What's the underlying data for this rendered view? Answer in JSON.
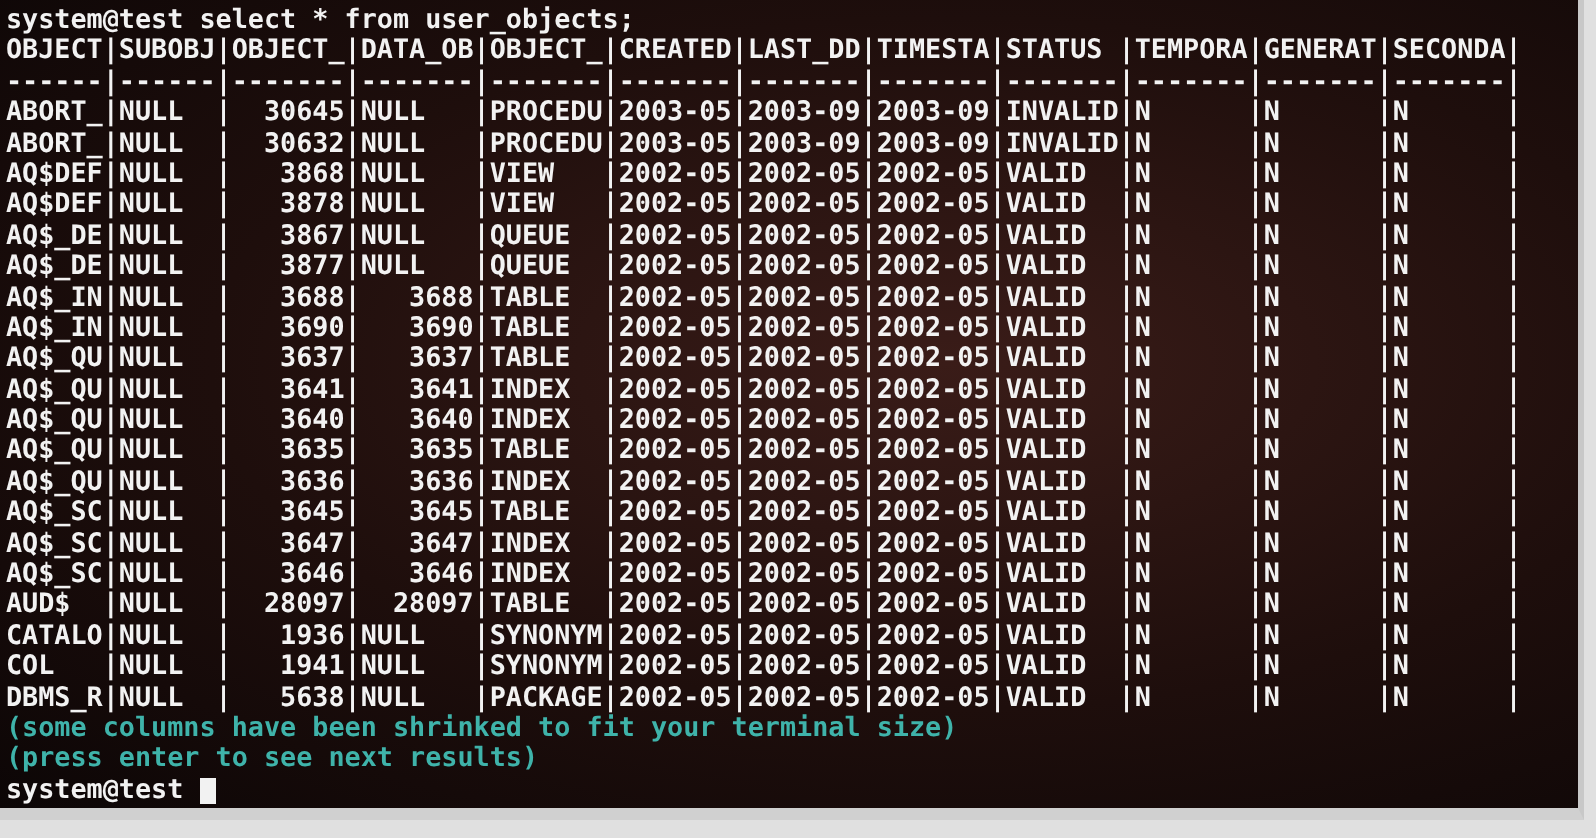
{
  "terminal": {
    "lines": [
      {
        "kind": "command",
        "text": "system@test select * from user_objects;"
      },
      {
        "kind": "output",
        "text": "OBJECT|SUBOBJ|OBJECT_|DATA_OB|OBJECT_|CREATED|LAST_DD|TIMESTA|STATUS |TEMPORA|GENERAT|SECONDA|"
      },
      {
        "kind": "output",
        "text": "------|------|-------|-------|-------|-------|-------|-------|-------|-------|-------|-------|"
      },
      {
        "kind": "output",
        "text": "ABORT_|NULL  |  30645|NULL   |PROCEDU|2003-05|2003-09|2003-09|INVALID|N      |N      |N      |"
      },
      {
        "kind": "output",
        "text": "ABORT_|NULL  |  30632|NULL   |PROCEDU|2003-05|2003-09|2003-09|INVALID|N      |N      |N      |"
      },
      {
        "kind": "output",
        "text": "AQ$DEF|NULL  |   3868|NULL   |VIEW   |2002-05|2002-05|2002-05|VALID  |N      |N      |N      |"
      },
      {
        "kind": "output",
        "text": "AQ$DEF|NULL  |   3878|NULL   |VIEW   |2002-05|2002-05|2002-05|VALID  |N      |N      |N      |"
      },
      {
        "kind": "output",
        "text": "AQ$_DE|NULL  |   3867|NULL   |QUEUE  |2002-05|2002-05|2002-05|VALID  |N      |N      |N      |"
      },
      {
        "kind": "output",
        "text": "AQ$_DE|NULL  |   3877|NULL   |QUEUE  |2002-05|2002-05|2002-05|VALID  |N      |N      |N      |"
      },
      {
        "kind": "output",
        "text": "AQ$_IN|NULL  |   3688|   3688|TABLE  |2002-05|2002-05|2002-05|VALID  |N      |N      |N      |"
      },
      {
        "kind": "output",
        "text": "AQ$_IN|NULL  |   3690|   3690|TABLE  |2002-05|2002-05|2002-05|VALID  |N      |N      |N      |"
      },
      {
        "kind": "output",
        "text": "AQ$_QU|NULL  |   3637|   3637|TABLE  |2002-05|2002-05|2002-05|VALID  |N      |N      |N      |"
      },
      {
        "kind": "output",
        "text": "AQ$_QU|NULL  |   3641|   3641|INDEX  |2002-05|2002-05|2002-05|VALID  |N      |N      |N      |"
      },
      {
        "kind": "output",
        "text": "AQ$_QU|NULL  |   3640|   3640|INDEX  |2002-05|2002-05|2002-05|VALID  |N      |N      |N      |"
      },
      {
        "kind": "output",
        "text": "AQ$_QU|NULL  |   3635|   3635|TABLE  |2002-05|2002-05|2002-05|VALID  |N      |N      |N      |"
      },
      {
        "kind": "output",
        "text": "AQ$_QU|NULL  |   3636|   3636|INDEX  |2002-05|2002-05|2002-05|VALID  |N      |N      |N      |"
      },
      {
        "kind": "output",
        "text": "AQ$_SC|NULL  |   3645|   3645|TABLE  |2002-05|2002-05|2002-05|VALID  |N      |N      |N      |"
      },
      {
        "kind": "output",
        "text": "AQ$_SC|NULL  |   3647|   3647|INDEX  |2002-05|2002-05|2002-05|VALID  |N      |N      |N      |"
      },
      {
        "kind": "output",
        "text": "AQ$_SC|NULL  |   3646|   3646|INDEX  |2002-05|2002-05|2002-05|VALID  |N      |N      |N      |"
      },
      {
        "kind": "output",
        "text": "AUD$  |NULL  |  28097|  28097|TABLE  |2002-05|2002-05|2002-05|VALID  |N      |N      |N      |"
      },
      {
        "kind": "output",
        "text": "CATALO|NULL  |   1936|NULL   |SYNONYM|2002-05|2002-05|2002-05|VALID  |N      |N      |N      |"
      },
      {
        "kind": "output",
        "text": "COL   |NULL  |   1941|NULL   |SYNONYM|2002-05|2002-05|2002-05|VALID  |N      |N      |N      |"
      },
      {
        "kind": "output",
        "text": "DBMS_R|NULL  |   5638|NULL   |PACKAGE|2002-05|2002-05|2002-05|VALID  |N      |N      |N      |"
      },
      {
        "kind": "notice",
        "text": "(some columns have been shrinked to fit your terminal size)"
      },
      {
        "kind": "notice",
        "text": "(press enter to see next results)"
      },
      {
        "kind": "prompt",
        "text": "system@test"
      }
    ]
  }
}
